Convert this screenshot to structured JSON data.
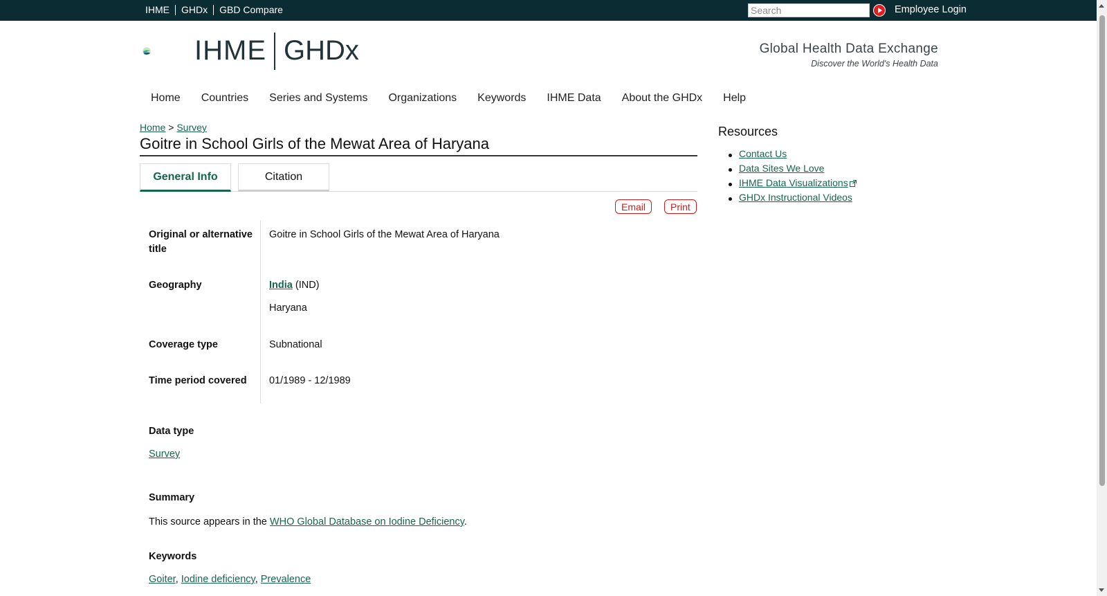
{
  "topbar": {
    "links": [
      "IHME",
      "GHDx",
      "GBD Compare"
    ],
    "search_placeholder": "Search",
    "login": "Employee Login"
  },
  "header": {
    "logo_left": "IHME",
    "logo_right": "GHDx",
    "tagline_title": "Global Health Data Exchange",
    "tagline_sub": "Discover the World's Health Data"
  },
  "nav": [
    "Home",
    "Countries",
    "Series and Systems",
    "Organizations",
    "Keywords",
    "IHME Data",
    "About the GHDx",
    "Help"
  ],
  "breadcrumb": {
    "home": "Home",
    "sep": ">",
    "current": "Survey"
  },
  "page": {
    "title": "Goitre in School Girls of the Mewat Area of Haryana",
    "tabs": [
      "General Info",
      "Citation"
    ],
    "email": "Email",
    "print": "Print"
  },
  "fields": {
    "alt_title_label": "Original or alternative title",
    "alt_title_value": "Goitre in School Girls of the Mewat Area of Haryana",
    "geography_label": "Geography",
    "geography_country": "India",
    "geography_code": "(IND)",
    "geography_region": "Haryana",
    "coverage_label": "Coverage type",
    "coverage_value": "Subnational",
    "time_label": "Time period covered",
    "time_value": "01/1989 - 12/1989"
  },
  "data_type": {
    "label": "Data type",
    "value": "Survey"
  },
  "summary": {
    "label": "Summary",
    "prefix": "This source appears in the ",
    "link": "WHO Global Database on Iodine Deficiency",
    "suffix": "."
  },
  "keywords": {
    "label": "Keywords",
    "items": [
      "Goiter",
      "Iodine deficiency",
      "Prevalence"
    ]
  },
  "resources": {
    "title": "Resources",
    "items": [
      "Contact Us",
      "Data Sites We Love",
      "IHME Data Visualizations",
      "GHDx Instructional Videos"
    ]
  },
  "icons": {
    "search_go": "play-circle-icon",
    "external": "external-link-icon",
    "logo": "ihme-leaf-logo-icon"
  },
  "colors": {
    "topbar": "#0b2c33",
    "link": "#16664f",
    "action": "#d01c1c"
  }
}
